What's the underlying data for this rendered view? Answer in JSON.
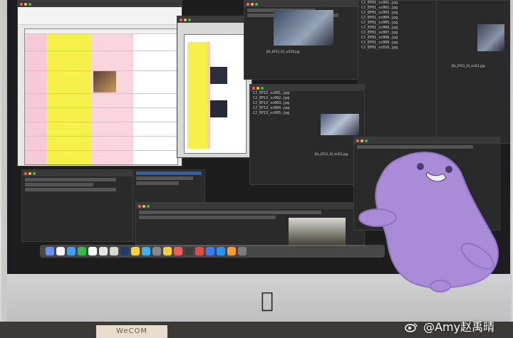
{
  "screenshot": {
    "watermark": "@Amy赵禹晴",
    "desk_box_text": "WeCOM",
    "captions": [
      "JSL_EP13_02_sc016.jpg",
      "JSL_EP13_10_sc011.jpg",
      "JSL_EP13_10_sc021.jpg"
    ]
  },
  "colors": {
    "accent_blob": "#a88bd6",
    "sheet_yellow": "#f5f04a",
    "sheet_pink": "#f7c9d6",
    "screen_dark": "#1d1d1d"
  },
  "icons": [
    "apple-logo-icon",
    "weibo-icon"
  ]
}
